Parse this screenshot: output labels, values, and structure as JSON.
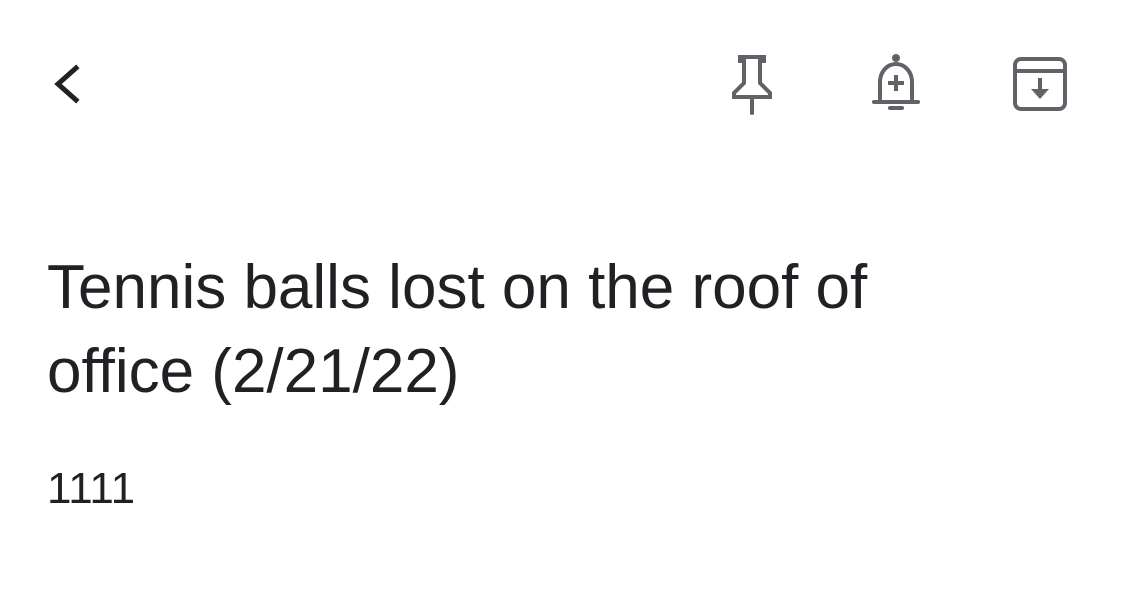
{
  "toolbar": {
    "back_icon": "chevron-left-icon",
    "pin_icon": "pin-icon",
    "reminder_icon": "add-alert-bell-icon",
    "archive_icon": "archive-icon",
    "icon_color": "#5f6368"
  },
  "note": {
    "title": "Tennis balls lost on the roof of office (2/21/22)",
    "body": "1111"
  }
}
